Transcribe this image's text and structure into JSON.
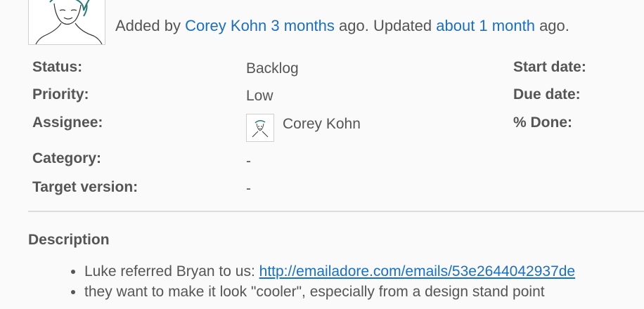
{
  "header": {
    "added_prefix": "Added by",
    "author": "Corey Kohn",
    "added_ago": "3 months",
    "mid_text": "ago. Updated",
    "updated_ago": "about 1 month",
    "suffix": "ago."
  },
  "attributes": {
    "status_label": "Status:",
    "status_value": "Backlog",
    "priority_label": "Priority:",
    "priority_value": "Low",
    "assignee_label": "Assignee:",
    "assignee_value": "Corey Kohn",
    "category_label": "Category:",
    "category_value": "-",
    "target_label": "Target version:",
    "target_value": "-",
    "start_label": "Start date:",
    "due_label": "Due date:",
    "done_label": "% Done:"
  },
  "description": {
    "title": "Description",
    "items": [
      {
        "text": "Luke referred Bryan to us: ",
        "link": "http://emailadore.com/emails/53e2644042937de"
      },
      {
        "text": "they want to make it look \"cooler\", especially from a design stand point"
      }
    ]
  },
  "colors": {
    "link": "#1a6fc4",
    "text": "#555555",
    "background": "#fafafa"
  },
  "icons": [
    "author-avatar-icon",
    "assignee-avatar-icon"
  ]
}
